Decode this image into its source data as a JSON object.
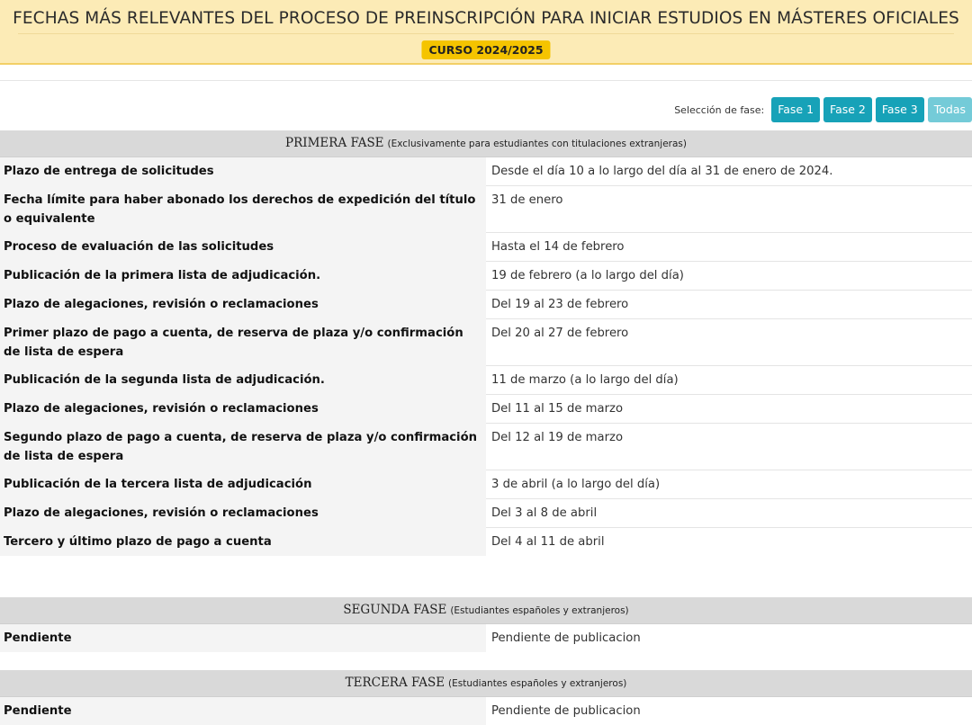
{
  "header": {
    "title": "FECHAS MÁS RELEVANTES DEL PROCESO DE PREINSCRIPCIÓN PARA INICIAR ESTUDIOS EN MÁSTERES OFICIALES",
    "course": "CURSO 2024/2025"
  },
  "phase_selector": {
    "label": "Selección de fase:",
    "buttons": [
      "Fase 1",
      "Fase 2",
      "Fase 3",
      "Todas"
    ]
  },
  "phases": [
    {
      "title": "PRIMERA FASE",
      "subtitle": "(Exclusivamente para estudiantes con titulaciones extranjeras)",
      "rows": [
        {
          "label": "Plazo de entrega de solicitudes",
          "value": "Desde el día 10 a lo largo del día al 31 de enero de 2024."
        },
        {
          "label": "Fecha límite para haber abonado los derechos de expedición del título o equivalente",
          "value": "31 de enero"
        },
        {
          "label": "Proceso de evaluación de las solicitudes",
          "value": "Hasta el 14 de febrero"
        },
        {
          "label": "Publicación de la primera lista de adjudicación.",
          "value": "19 de febrero (a lo largo del día)"
        },
        {
          "label": "Plazo de alegaciones, revisión o reclamaciones",
          "value": "Del 19 al 23 de febrero"
        },
        {
          "label": "Primer plazo de pago a cuenta, de reserva de plaza y/o confirmación de lista de espera",
          "value": "Del 20 al 27 de febrero"
        },
        {
          "label": "Publicación de la segunda lista de adjudicación.",
          "value": "11 de marzo (a lo largo del día)"
        },
        {
          "label": "Plazo de alegaciones, revisión o reclamaciones",
          "value": "Del 11 al 15 de marzo"
        },
        {
          "label": "Segundo plazo de pago a cuenta, de reserva de plaza y/o confirmación de lista de espera",
          "value": "Del 12 al 19 de marzo"
        },
        {
          "label": "Publicación de la tercera lista de adjudicación",
          "value": "3 de abril (a lo largo del día)"
        },
        {
          "label": "Plazo de alegaciones, revisión o reclamaciones",
          "value": "Del 3 al 8 de abril"
        },
        {
          "label": "Tercero y último plazo de pago a cuenta",
          "value": "Del 4 al 11 de abril"
        }
      ]
    },
    {
      "title": "SEGUNDA FASE",
      "subtitle": "(Estudiantes españoles y extranjeros)",
      "rows": [
        {
          "label": "Pendiente",
          "value": "Pendiente de publicacion"
        }
      ]
    },
    {
      "title": "TERCERA FASE",
      "subtitle": "(Estudiantes españoles y extranjeros)",
      "rows": [
        {
          "label": "Pendiente",
          "value": "Pendiente de publicacion"
        }
      ]
    }
  ]
}
